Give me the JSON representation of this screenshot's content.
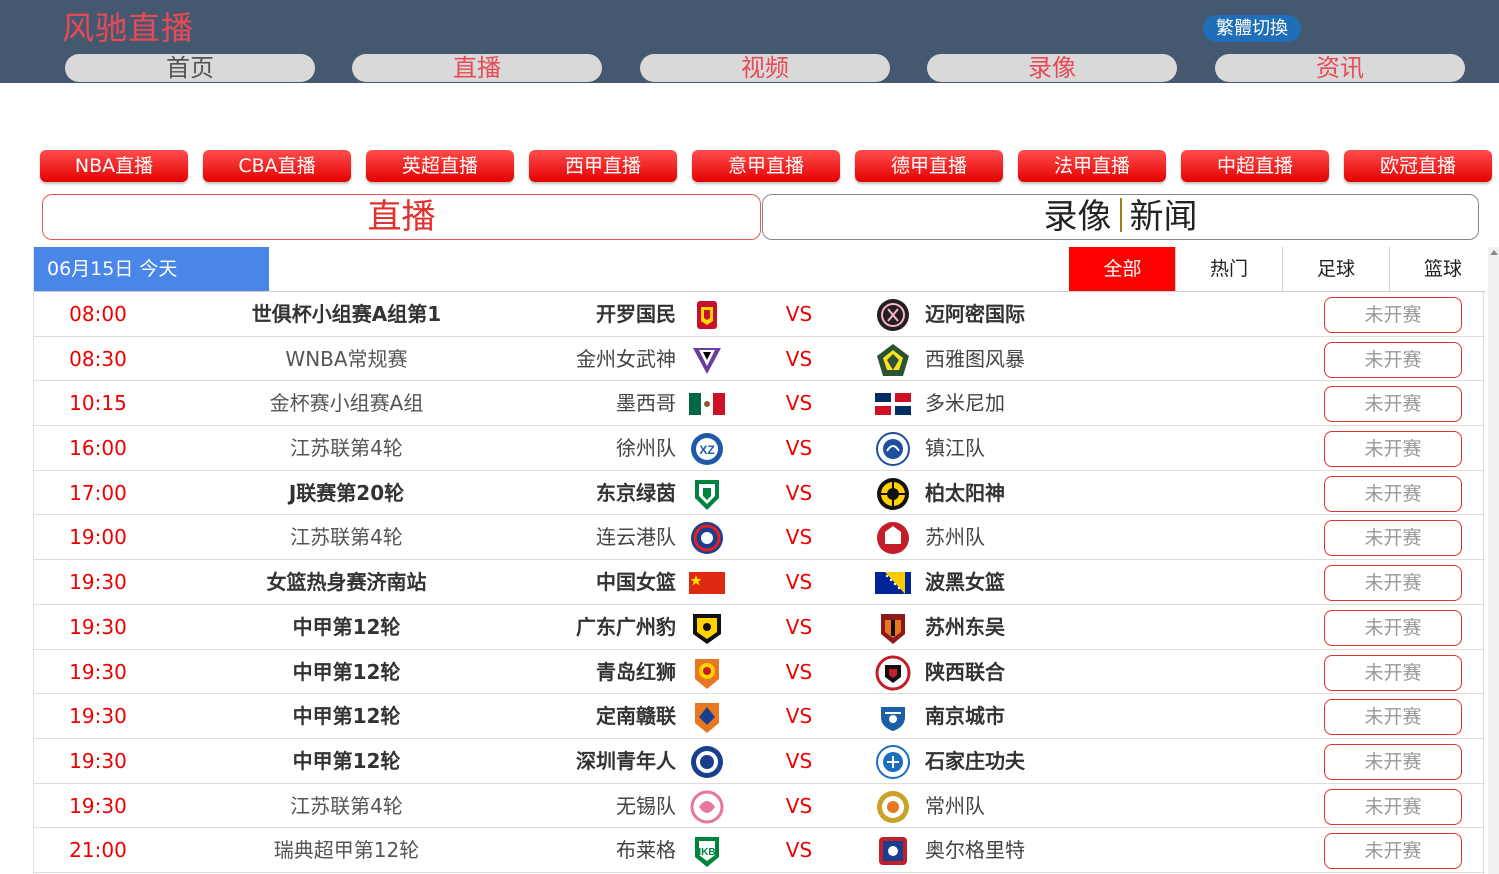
{
  "site": {
    "logo": "风驰直播",
    "trad_toggle": "繁體切換"
  },
  "nav": [
    "首页",
    "直播",
    "视频",
    "录像",
    "资讯"
  ],
  "leagues": [
    "NBA直播",
    "CBA直播",
    "英超直播",
    "西甲直播",
    "意甲直播",
    "德甲直播",
    "法甲直播",
    "中超直播",
    "欧冠直播"
  ],
  "bigtabs": {
    "live": "直播",
    "record": "录像",
    "news": "新闻"
  },
  "date": "06月15日 今天",
  "filters": [
    "全部",
    "热门",
    "足球",
    "篮球"
  ],
  "vs": "VS",
  "colors": {
    "header_bg": "#44596f",
    "accent_red": "#e00000",
    "date_blue": "#4a86e8",
    "toggle_blue": "#1f6fb8"
  },
  "matches": [
    {
      "time": "08:00",
      "league": "世俱杯小组赛A组第1",
      "home": "开罗国民",
      "away": "迈阿密国际",
      "status": "未开赛",
      "bold": true,
      "home_icon": "al-ahly-crest-icon",
      "away_icon": "inter-miami-crest-icon"
    },
    {
      "time": "08:30",
      "league": "WNBA常规赛",
      "home": "金州女武神",
      "away": "西雅图风暴",
      "status": "未开赛",
      "bold": false,
      "home_icon": "valkyries-logo-icon",
      "away_icon": "storm-logo-icon"
    },
    {
      "time": "10:15",
      "league": "金杯赛小组赛A组",
      "home": "墨西哥",
      "away": "多米尼加",
      "status": "未开赛",
      "bold": false,
      "home_icon": "mexico-flag-icon",
      "away_icon": "dominican-flag-icon"
    },
    {
      "time": "16:00",
      "league": "江苏联第4轮",
      "home": "徐州队",
      "away": "镇江队",
      "status": "未开赛",
      "bold": false,
      "home_icon": "xuzhou-crest-icon",
      "away_icon": "zhenjiang-crest-icon"
    },
    {
      "time": "17:00",
      "league": "J联赛第20轮",
      "home": "东京绿茵",
      "away": "柏太阳神",
      "status": "未开赛",
      "bold": true,
      "home_icon": "tokyo-verdy-crest-icon",
      "away_icon": "kashiwa-reysol-crest-icon"
    },
    {
      "time": "19:00",
      "league": "江苏联第4轮",
      "home": "连云港队",
      "away": "苏州队",
      "status": "未开赛",
      "bold": false,
      "home_icon": "lianyungang-crest-icon",
      "away_icon": "suzhou-crest-icon"
    },
    {
      "time": "19:30",
      "league": "女篮热身赛济南站",
      "home": "中国女篮",
      "away": "波黑女篮",
      "status": "未开赛",
      "bold": true,
      "home_icon": "china-flag-icon",
      "away_icon": "bosnia-flag-icon"
    },
    {
      "time": "19:30",
      "league": "中甲第12轮",
      "home": "广东广州豹",
      "away": "苏州东吴",
      "status": "未开赛",
      "bold": true,
      "home_icon": "guangzhou-leopards-crest-icon",
      "away_icon": "suzhou-dongwu-crest-icon"
    },
    {
      "time": "19:30",
      "league": "中甲第12轮",
      "home": "青岛红狮",
      "away": "陕西联合",
      "status": "未开赛",
      "bold": true,
      "home_icon": "qingdao-red-lions-crest-icon",
      "away_icon": "shaanxi-union-crest-icon"
    },
    {
      "time": "19:30",
      "league": "中甲第12轮",
      "home": "定南赣联",
      "away": "南京城市",
      "status": "未开赛",
      "bold": true,
      "home_icon": "dingnan-crest-icon",
      "away_icon": "nanjing-city-crest-icon"
    },
    {
      "time": "19:30",
      "league": "中甲第12轮",
      "home": "深圳青年人",
      "away": "石家庄功夫",
      "status": "未开赛",
      "bold": true,
      "home_icon": "shenzhen-youth-crest-icon",
      "away_icon": "shijiazhuang-kungfu-crest-icon"
    },
    {
      "time": "19:30",
      "league": "江苏联第4轮",
      "home": "无锡队",
      "away": "常州队",
      "status": "未开赛",
      "bold": false,
      "home_icon": "wuxi-crest-icon",
      "away_icon": "changzhou-crest-icon"
    },
    {
      "time": "21:00",
      "league": "瑞典超甲第12轮",
      "home": "布莱格",
      "away": "奥尔格里特",
      "status": "未开赛",
      "bold": false,
      "home_icon": "brage-crest-icon",
      "away_icon": "orgryte-crest-icon"
    }
  ]
}
